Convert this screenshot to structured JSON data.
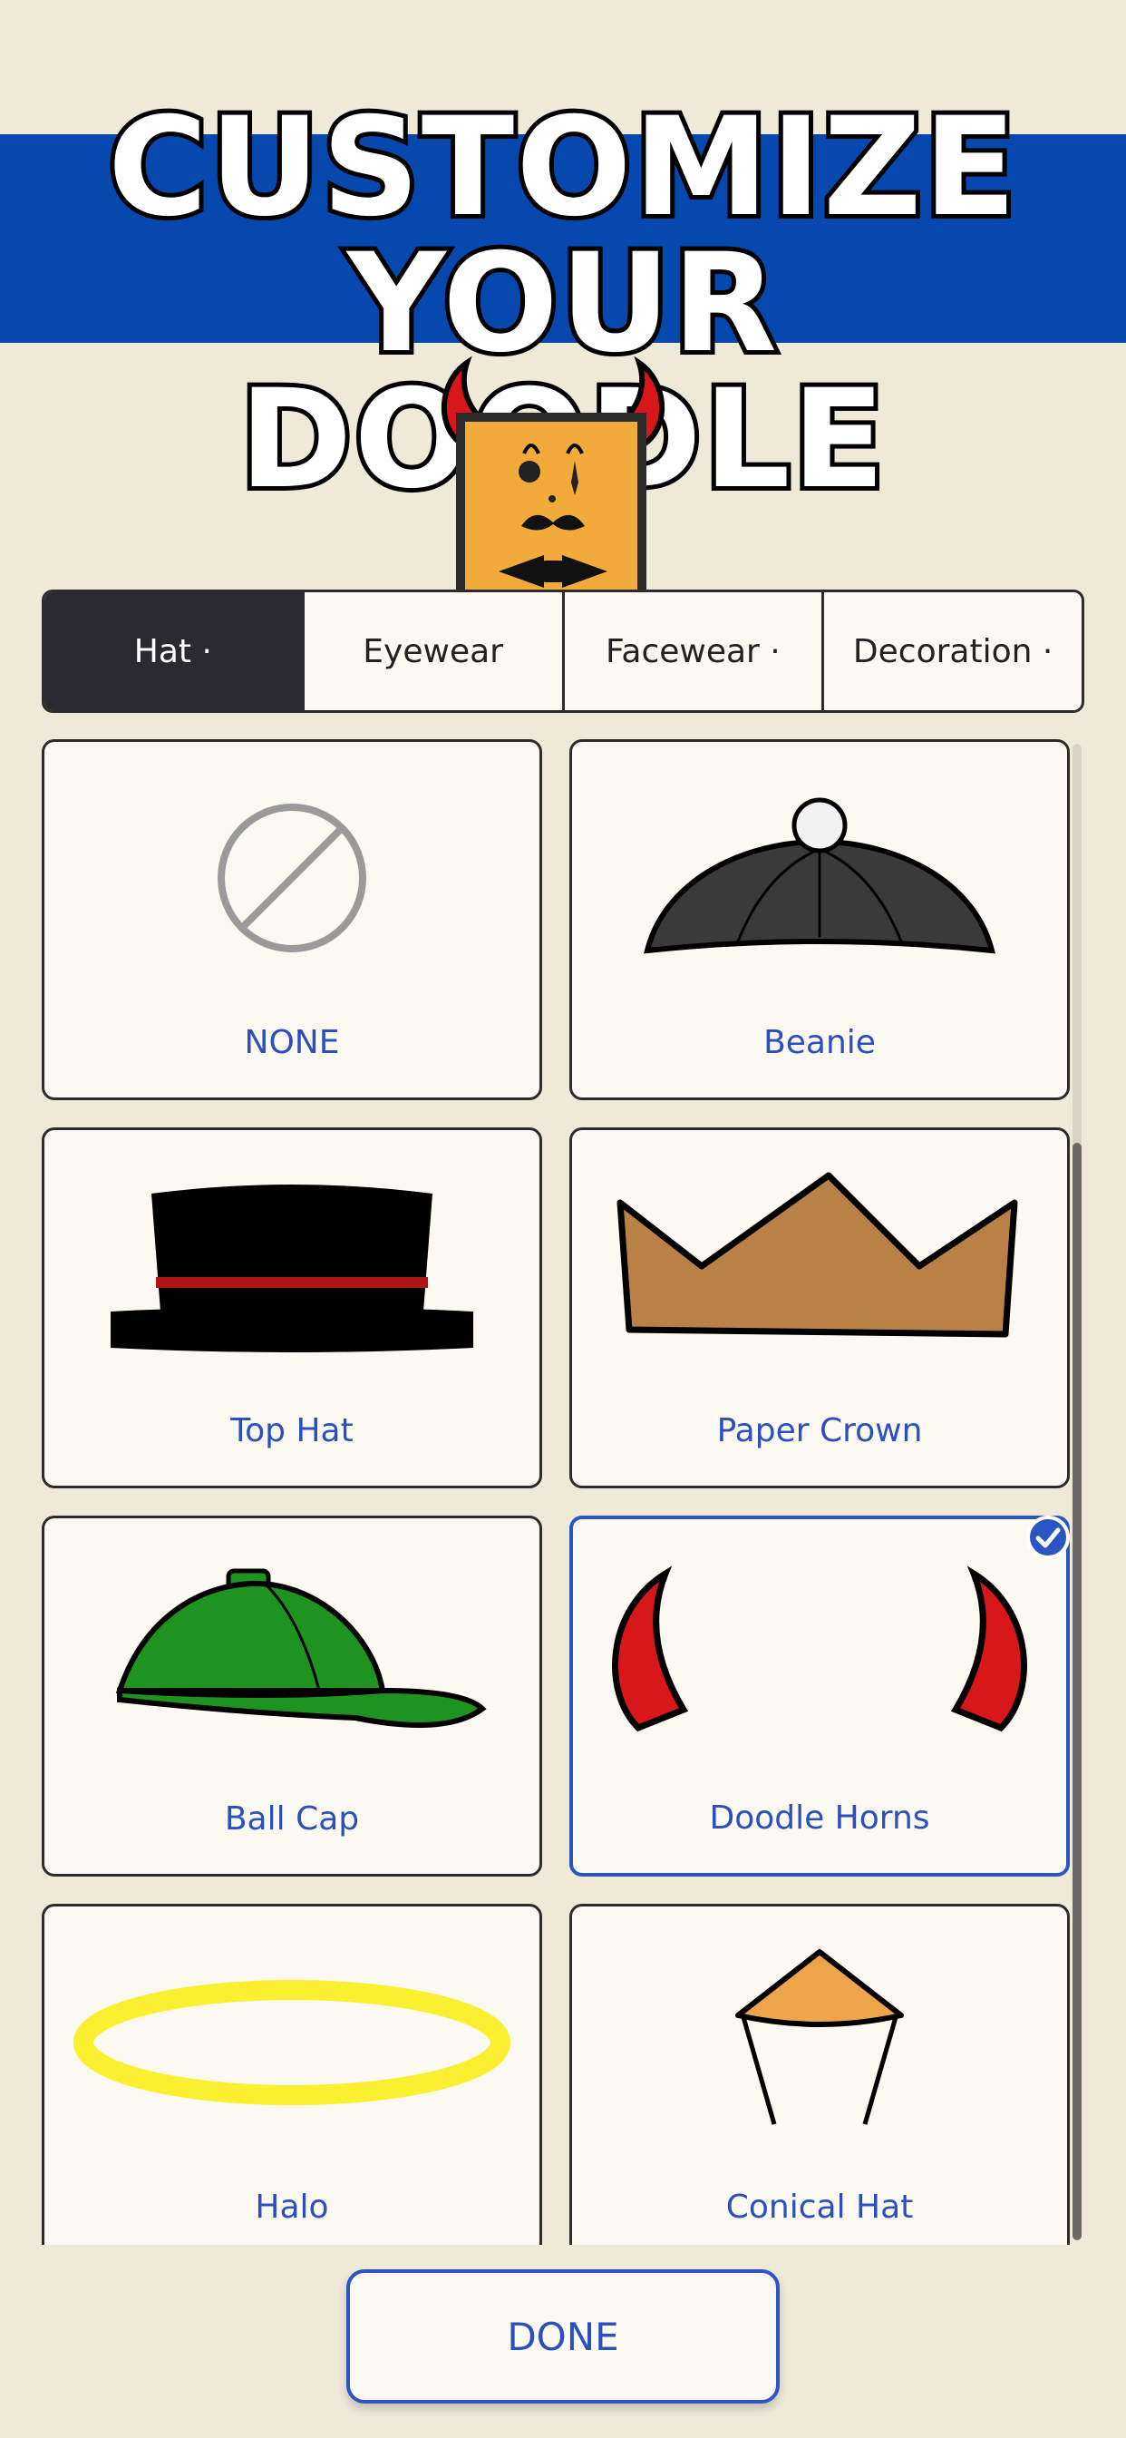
{
  "header": {
    "title_line1": "CUSTOMIZE",
    "title_line2": "YOUR DOODLE"
  },
  "colors": {
    "banner": "#0648ad",
    "label_text": "#2b4fbf",
    "selected_border": "#2a56c4",
    "active_tab": "#2a2a30"
  },
  "tabs": [
    {
      "label": "Hat ·",
      "active": true
    },
    {
      "label": "Eyewear",
      "active": false
    },
    {
      "label": "Facewear ·",
      "active": false
    },
    {
      "label": "Decoration ·",
      "active": false
    }
  ],
  "items": [
    {
      "label": "NONE",
      "icon": "none-icon",
      "selected": false
    },
    {
      "label": "Beanie",
      "icon": "beanie-icon",
      "selected": false
    },
    {
      "label": "Top Hat",
      "icon": "top-hat-icon",
      "selected": false
    },
    {
      "label": "Paper Crown",
      "icon": "paper-crown-icon",
      "selected": false
    },
    {
      "label": "Ball Cap",
      "icon": "ball-cap-icon",
      "selected": false
    },
    {
      "label": "Doodle Horns",
      "icon": "doodle-horns-icon",
      "selected": true
    },
    {
      "label": "Halo",
      "icon": "halo-icon",
      "selected": false
    },
    {
      "label": "Conical Hat",
      "icon": "conical-hat-icon",
      "selected": false
    }
  ],
  "done_label": "DONE"
}
